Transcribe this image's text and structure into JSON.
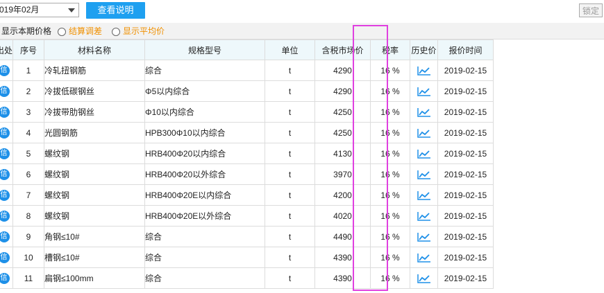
{
  "toolbar": {
    "period_value": "019年02月",
    "view_button": "查看说明",
    "lock_button": "锁定"
  },
  "options": {
    "show_period_price": "显示本期价格",
    "settlement_adjust": "结算调差",
    "show_average": "显示平均价"
  },
  "columns": [
    "出处",
    "序号",
    "材料名称",
    "规格型号",
    "单位",
    "含税市场价",
    "税率",
    "历史价",
    "报价时间"
  ],
  "colors": {
    "accent": "#1ea0f0",
    "highlight_box": "#e040e0",
    "option_orange": "#f09000"
  },
  "rows": [
    {
      "seq": "1",
      "name": "冷轧扭钢筋",
      "spec": "综合",
      "unit": "t",
      "price": "4290",
      "tax": "16 %",
      "date": "2019-02-15"
    },
    {
      "seq": "2",
      "name": "冷拔低碳钢丝",
      "spec": "Φ5以内综合",
      "unit": "t",
      "price": "4290",
      "tax": "16 %",
      "date": "2019-02-15"
    },
    {
      "seq": "3",
      "name": "冷拔带肋钢丝",
      "spec": "Φ10以内综合",
      "unit": "t",
      "price": "4250",
      "tax": "16 %",
      "date": "2019-02-15"
    },
    {
      "seq": "4",
      "name": "光圆钢筋",
      "spec": "HPB300Φ10以内综合",
      "unit": "t",
      "price": "4250",
      "tax": "16 %",
      "date": "2019-02-15"
    },
    {
      "seq": "5",
      "name": "螺纹钢",
      "spec": "HRB400Φ20以内综合",
      "unit": "t",
      "price": "4130",
      "tax": "16 %",
      "date": "2019-02-15"
    },
    {
      "seq": "6",
      "name": "螺纹钢",
      "spec": "HRB400Φ20以外综合",
      "unit": "t",
      "price": "3970",
      "tax": "16 %",
      "date": "2019-02-15"
    },
    {
      "seq": "7",
      "name": "螺纹钢",
      "spec": "HRB400Φ20E以内综合",
      "unit": "t",
      "price": "4200",
      "tax": "16 %",
      "date": "2019-02-15"
    },
    {
      "seq": "8",
      "name": "螺纹钢",
      "spec": "HRB400Φ20E以外综合",
      "unit": "t",
      "price": "4020",
      "tax": "16 %",
      "date": "2019-02-15"
    },
    {
      "seq": "9",
      "name": "角钢≤10#",
      "spec": "综合",
      "unit": "t",
      "price": "4490",
      "tax": "16 %",
      "date": "2019-02-15"
    },
    {
      "seq": "10",
      "name": "槽钢≤10#",
      "spec": "综合",
      "unit": "t",
      "price": "4390",
      "tax": "16 %",
      "date": "2019-02-15"
    },
    {
      "seq": "11",
      "name": "扁钢≤100mm",
      "spec": "综合",
      "unit": "t",
      "price": "4390",
      "tax": "16 %",
      "date": "2019-02-15"
    }
  ],
  "row_icons": {
    "source": "info-icon",
    "history": "line-chart-icon"
  },
  "source_icon_glyph": "信"
}
